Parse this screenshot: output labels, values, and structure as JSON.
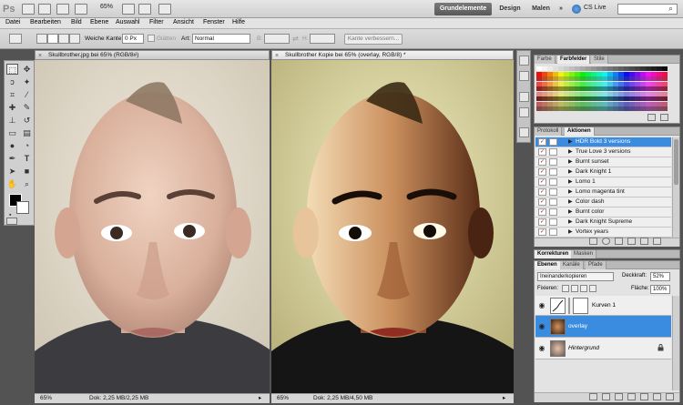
{
  "app": {
    "logo": "Ps",
    "zoom": "65%",
    "workspaces": [
      "Grundelemente",
      "Design",
      "Malen"
    ],
    "more": "»",
    "cs_live": "CS Live"
  },
  "menu": [
    "Datei",
    "Bearbeiten",
    "Bild",
    "Ebene",
    "Auswahl",
    "Filter",
    "Ansicht",
    "Fenster",
    "Hilfe"
  ],
  "options": {
    "feather_label": "Weiche Kante:",
    "feather_value": "0 Px",
    "antialias_label": "Glätten",
    "style_label": "Art:",
    "style_value": "Normal",
    "width_label": "B:",
    "height_label": "H:",
    "refine_label": "Kante verbessern..."
  },
  "documents": [
    {
      "tab": "Skullbrother.jpg bei 65% (RGB/8#)",
      "zoom": "65%",
      "doc_info": "Dok: 2,25 MB/2,25 MB"
    },
    {
      "tab": "Skullbrother Kopie bei 65% (overlay, RGB/8) *",
      "zoom": "65%",
      "doc_info": "Dok: 2,25 MB/4,50 MB"
    }
  ],
  "swatches_panel": {
    "tabs": [
      "Farbe",
      "Farbfelder",
      "Stile"
    ],
    "active": 1
  },
  "actions_panel": {
    "tabs": [
      "Protokoll",
      "Aktionen"
    ],
    "active": 1,
    "items": [
      {
        "label": "HDR Bold 3 versions",
        "checked": true,
        "selected": true
      },
      {
        "label": "True Love 3 versions",
        "checked": true,
        "selected": false
      },
      {
        "label": "Burnt sunset",
        "checked": true,
        "selected": false
      },
      {
        "label": "Dark Knight 1",
        "checked": true,
        "selected": false
      },
      {
        "label": "Lomo 1",
        "checked": true,
        "selected": false
      },
      {
        "label": "Lomo magenta tint",
        "checked": true,
        "selected": false
      },
      {
        "label": "Color dash",
        "checked": true,
        "selected": false
      },
      {
        "label": "Burnt color",
        "checked": true,
        "selected": false
      },
      {
        "label": "Dark Knight Supreme",
        "checked": true,
        "selected": false
      },
      {
        "label": "Vortex years",
        "checked": true,
        "selected": false
      }
    ]
  },
  "adjust_panel": {
    "tabs": [
      "Korrekturen",
      "Masken"
    ],
    "active": 0
  },
  "layers_panel": {
    "tabs": [
      "Ebenen",
      "Kanäle",
      "Pfade"
    ],
    "active": 0,
    "blend_mode": "Ineinanderkopieren",
    "opacity_label": "Deckkraft:",
    "opacity_value": "52%",
    "lock_label": "Fixieren:",
    "fill_label": "Fläche:",
    "fill_value": "100%",
    "layers": [
      {
        "name": "Kurven 1",
        "selected": false,
        "italic": false,
        "locked": false
      },
      {
        "name": "overlay",
        "selected": true,
        "italic": false,
        "locked": false
      },
      {
        "name": "Hintergrund",
        "selected": false,
        "italic": true,
        "locked": true
      }
    ]
  },
  "icons": {
    "lock": "lock-icon",
    "eye": "eye-icon",
    "close": "close-icon"
  }
}
